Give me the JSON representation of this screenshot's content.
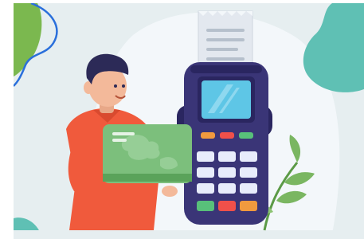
{
  "illustration": {
    "subject": "card-payment-scene",
    "colors": {
      "background": "#e6eef0",
      "blob_green": "#7bb84f",
      "blob_teal": "#5fc0b4",
      "outline_blue": "#2a6fdb",
      "terminal_body": "#3a3577",
      "terminal_dark": "#2a2660",
      "screen": "#5ec6e6",
      "card": "#7cbf7c",
      "shirt": "#f05a3c",
      "skin": "#f3b99a",
      "hair": "#2c2a57",
      "leaf": "#7ab661",
      "key": "#e8ecfb",
      "key_green": "#58c07a",
      "key_red": "#f0504a",
      "key_orange": "#f19a3e"
    },
    "icons": [
      "receipt-icon",
      "payment-terminal-icon",
      "credit-card-icon",
      "person-icon",
      "plant-icon"
    ]
  }
}
